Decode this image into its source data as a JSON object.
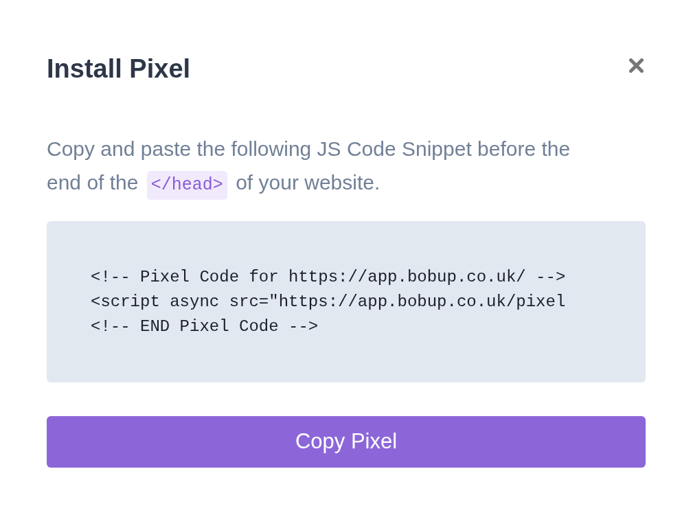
{
  "dialog": {
    "title": "Install Pixel",
    "instructions": [
      {
        "kind": "text",
        "text": "Copy and paste the following JS Code Snippet before the end of the"
      },
      {
        "kind": "code",
        "text": "</head>"
      },
      {
        "kind": "text",
        "text": "of your website."
      }
    ],
    "code_lines": [
      "<!-- Pixel Code for https://app.bobup.co.uk/ -->",
      "<script async src=\"https://app.bobup.co.uk/pixel",
      "<!-- END Pixel Code -->"
    ],
    "copy_button": "Copy Pixel"
  }
}
